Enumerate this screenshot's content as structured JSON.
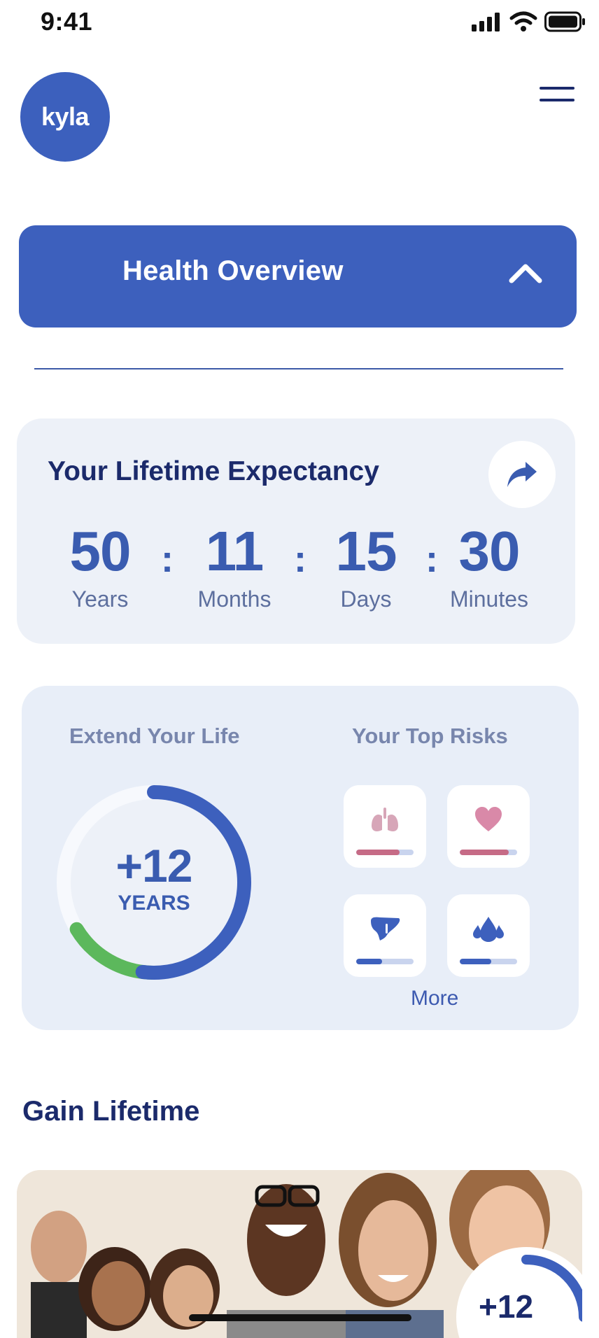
{
  "status_bar": {
    "time": "9:41"
  },
  "header": {
    "logo_text": "kyla"
  },
  "overview": {
    "title": "Health Overview"
  },
  "lifetime": {
    "title": "Your Lifetime Expectancy",
    "units": [
      {
        "value": "50",
        "label": "Years"
      },
      {
        "value": "11",
        "label": "Months"
      },
      {
        "value": "15",
        "label": "Days"
      },
      {
        "value": "30",
        "label": "Minutes"
      }
    ]
  },
  "extend": {
    "title": "Extend Your Life",
    "ring_value": "+12",
    "ring_unit": "YEARS",
    "blue_fraction": 0.52,
    "green_fraction": 0.16
  },
  "risks": {
    "title": "Your Top Risks",
    "items": [
      {
        "icon": "lungs-icon",
        "color": "#d7a6b8",
        "fill": 0.75,
        "fill_color": "#c66b86"
      },
      {
        "icon": "heart-icon",
        "color": "#d989a8",
        "fill": 0.85,
        "fill_color": "#c66b86"
      },
      {
        "icon": "liver-icon",
        "color": "#3d60bd",
        "fill": 0.45,
        "fill_color": "#3d60bd"
      },
      {
        "icon": "drops-icon",
        "color": "#3d60bd",
        "fill": 0.55,
        "fill_color": "#3d60bd"
      }
    ],
    "more_label": "More"
  },
  "gain": {
    "title": "Gain Lifetime",
    "badge_value": "+12"
  },
  "colors": {
    "primary": "#3d60bd",
    "navy": "#1b2a6b",
    "green": "#5cb85c"
  }
}
